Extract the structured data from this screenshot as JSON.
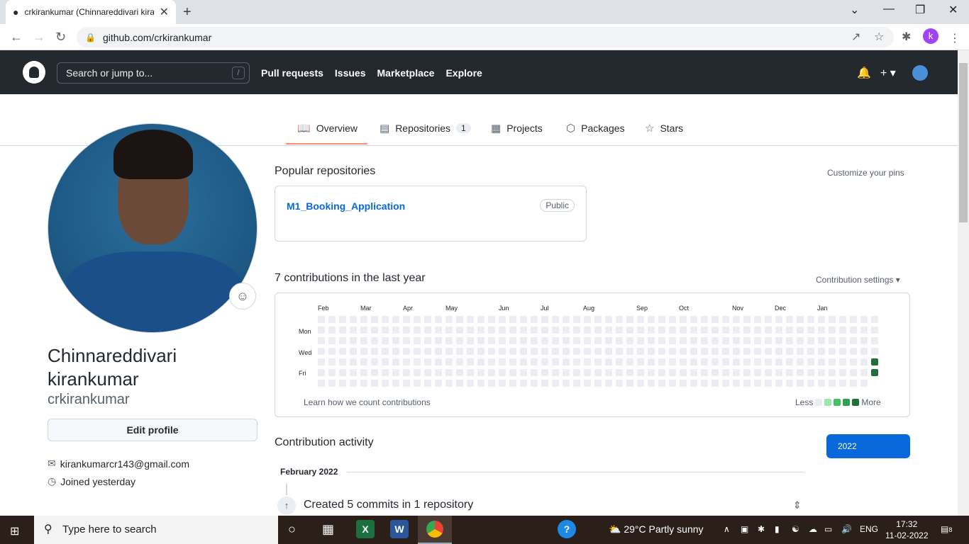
{
  "browser": {
    "tab_title": "crkirankumar (Chinnareddivari kiranku",
    "url": "github.com/crkirankumar",
    "profile_initial": "k"
  },
  "gh_header": {
    "search_placeholder": "Search or jump to...",
    "search_shortcut": "/",
    "nav": [
      "Pull requests",
      "Issues",
      "Marketplace",
      "Explore"
    ]
  },
  "profile_tabs": {
    "overview": "Overview",
    "repositories": "Repositories",
    "repositories_count": "1",
    "projects": "Projects",
    "packages": "Packages",
    "stars": "Stars"
  },
  "profile": {
    "name_line1": "Chinnareddivari",
    "name_line2": "kirankumar",
    "login": "crkirankumar",
    "edit_button": "Edit profile",
    "email": "kirankumarcr143@gmail.com",
    "joined": "Joined yesterday"
  },
  "popular": {
    "heading": "Popular repositories",
    "customize": "Customize your pins",
    "repo_name": "M1_Booking_Application",
    "repo_visibility": "Public"
  },
  "contributions": {
    "heading": "7 contributions in the last year",
    "settings": "Contribution settings ▾",
    "months": [
      "Feb",
      "Mar",
      "Apr",
      "May",
      "Jun",
      "Jul",
      "Aug",
      "Sep",
      "Oct",
      "Nov",
      "Dec",
      "Jan"
    ],
    "days": [
      "Mon",
      "Wed",
      "Fri"
    ],
    "learn": "Learn how we count contributions",
    "less": "Less",
    "more": "More",
    "active_days": [
      [
        52,
        4
      ],
      [
        52,
        5
      ]
    ],
    "colors": {
      "empty": "#ebedf0",
      "l1": "#9be9a8",
      "l2": "#40c463",
      "l3": "#30a14e",
      "l4": "#216e39"
    }
  },
  "activity": {
    "heading": "Contribution activity",
    "year": "2022",
    "month": "February 2022",
    "summary": "Created 5 commits in 1 repository"
  },
  "taskbar": {
    "search": "Type here to search",
    "weather": "29°C  Partly sunny",
    "lang": "ENG",
    "time": "17:32",
    "date": "11-02-2022",
    "notif_count": "8"
  }
}
